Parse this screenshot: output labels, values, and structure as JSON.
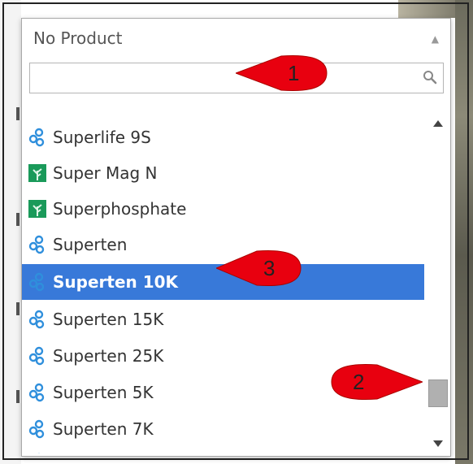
{
  "dropdown": {
    "selected_text": "No Product",
    "search": {
      "value": "",
      "placeholder": "",
      "icon": "search-icon"
    },
    "items": [
      {
        "label": "Superlife 9S",
        "icon": "molecule-icon",
        "selected": false
      },
      {
        "label": "Super Mag N",
        "icon": "plant-icon",
        "selected": false
      },
      {
        "label": "Superphosphate",
        "icon": "plant-icon",
        "selected": false
      },
      {
        "label": "Superten",
        "icon": "molecule-icon",
        "selected": false
      },
      {
        "label": "Superten 10K",
        "icon": "molecule-icon",
        "selected": true
      },
      {
        "label": "Superten 15K",
        "icon": "molecule-icon",
        "selected": false
      },
      {
        "label": "Superten 25K",
        "icon": "molecule-icon",
        "selected": false
      },
      {
        "label": "Superten 5K",
        "icon": "molecule-icon",
        "selected": false
      },
      {
        "label": "Superten 7K",
        "icon": "molecule-icon",
        "selected": false
      }
    ],
    "scrollbar": {
      "position_fraction": 0.9
    }
  },
  "callouts": [
    {
      "label": "1",
      "target": "search-input"
    },
    {
      "label": "2",
      "target": "scrollbar-thumb"
    },
    {
      "label": "3",
      "target": "selected-item"
    }
  ],
  "colors": {
    "selected_bg": "#3879d9",
    "molecule_icon": "#2f8fdc",
    "plant_icon_bg": "#1a9a5a",
    "callout_fill": "#e8000f"
  }
}
